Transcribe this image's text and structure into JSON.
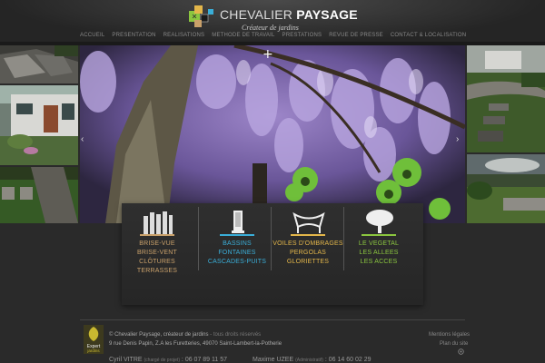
{
  "header": {
    "brand_first": "CHEVALIER ",
    "brand_second": "PAYSAGE",
    "tagline": "Créateur de jardins",
    "nav": [
      "ACCUEIL",
      "PRESENTATION",
      "REALISATIONS",
      "METHODE DE TRAVAIL",
      "PRESTATIONS",
      "REVUE DE PRESSE",
      "CONTACT & LOCALISATION"
    ]
  },
  "gallery": {
    "plus_glyph": "+",
    "prev_glyph": "‹",
    "next_glyph": "›"
  },
  "categories": [
    {
      "color": "#c9a06a",
      "bar": "#c9a06a",
      "links": [
        "BRISE-VUE",
        "BRISE-VENT",
        "CLÔTURES",
        "TERRASSES"
      ]
    },
    {
      "color": "#3aaed8",
      "bar": "#3aaed8",
      "links": [
        "BASSINS",
        "FONTAINES",
        "CASCADES-PUITS"
      ]
    },
    {
      "color": "#e3b64a",
      "bar": "#e3b64a",
      "links": [
        "VOILES D'OMBRAGES",
        "PERGOLAS",
        "GLORIETTES"
      ]
    },
    {
      "color": "#8bc63f",
      "bar": "#8bc63f",
      "links": [
        "LE VEGETAL",
        "LES ALLEES",
        "LES ACCES"
      ]
    }
  ],
  "footer": {
    "copyright": "© Chevalier Paysage, créateur de jardins",
    "rights": " - tous droits réservés",
    "address": "9 rue Denis Papin, Z.A les Furetteries, 49070 Saint-Lambert-la-Potherie",
    "legal": "Mentions légales",
    "sitemap": "Plan du site",
    "expert_1": "Expert",
    "expert_2": "jardins",
    "contact_1_name": "Cyril VITRE",
    "contact_1_note": "(chargé de projet)",
    "contact_1_phone": "06 07 89 11 57",
    "contact_2_name": "Maxime UZEE",
    "contact_2_note": "(Administratif)",
    "contact_2_phone": "06 14 60 02 29"
  }
}
